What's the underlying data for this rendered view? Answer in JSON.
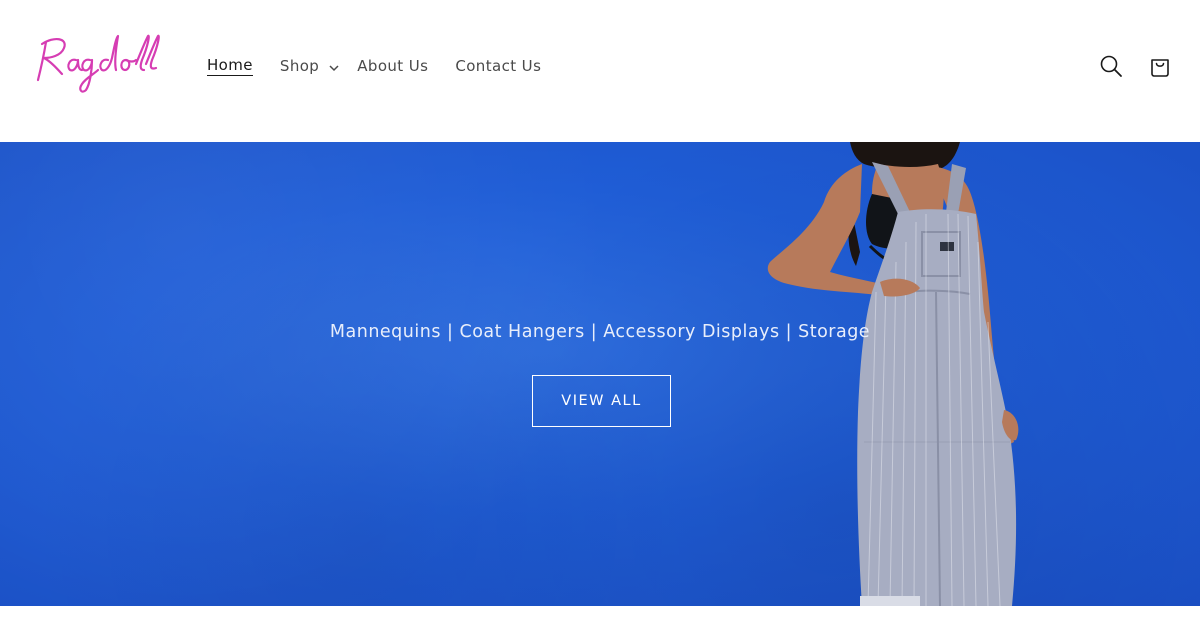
{
  "brand": {
    "logo_text": "Ragdoll",
    "logo_color": "#d63db3"
  },
  "nav": {
    "items": [
      {
        "label": "Home",
        "active": true
      },
      {
        "label": "Shop",
        "has_dropdown": true
      },
      {
        "label": "About Us"
      },
      {
        "label": "Contact Us"
      }
    ]
  },
  "header_icons": {
    "search": "search-icon",
    "cart": "cart-icon"
  },
  "hero": {
    "tagline": "Mannequins | Coat Hangers | Accessory Displays | Storage",
    "button_label": "VIEW ALL",
    "background_color": "#1f5dd6"
  }
}
